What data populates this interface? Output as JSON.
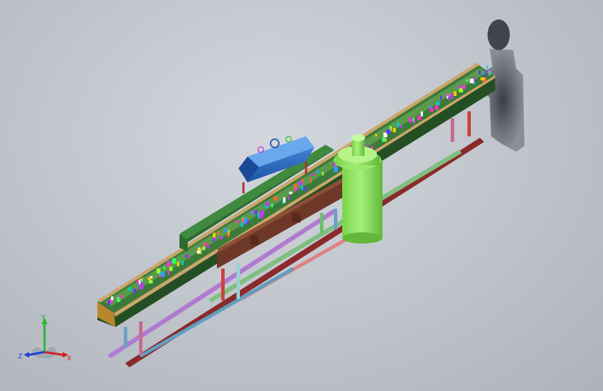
{
  "viewport": {
    "background_top": "#d3d7dd",
    "background_bottom": "#aeb3bb"
  },
  "triad": {
    "x_label": "X",
    "y_label": "Y",
    "z_label": "Z",
    "x_color": "#d81e1e",
    "y_color": "#2bb52b",
    "z_color": "#1e3ed8"
  },
  "model": {
    "frame_color": "#2e6b2e",
    "rail_color": "#3a3a3a",
    "end_cap_color": "#b8862d",
    "bin_color": "#1e4f9e",
    "bin_top_color": "#5aa0e8",
    "cylinder_color": "#8ee05a",
    "beam_color": "#7a3f2c",
    "leg_colors": [
      "#6aa0c8",
      "#c96a8e",
      "#d04040",
      "#9ad0d0",
      "#6bbf6b"
    ],
    "part_colors": [
      "#ff33cc",
      "#33ff66",
      "#3399ff",
      "#ffcc00",
      "#cc33ff",
      "#00cccc",
      "#ff6633",
      "#ffffff",
      "#99ff33",
      "#6633ff"
    ]
  }
}
